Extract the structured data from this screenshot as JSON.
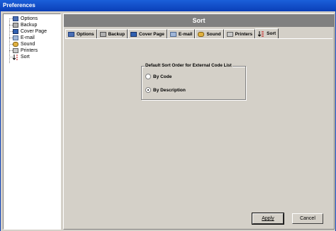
{
  "window": {
    "title": "Preferences"
  },
  "tree": {
    "items": [
      {
        "label": "Options",
        "icon": "options-icon",
        "color": "#4a6fb5"
      },
      {
        "label": "Backup",
        "icon": "backup-icon",
        "color": "#7f7f7f"
      },
      {
        "label": "Cover Page",
        "icon": "cover-page-icon",
        "color": "#3060b0"
      },
      {
        "label": "E-mail",
        "icon": "email-icon",
        "color": "#6f8fbf"
      },
      {
        "label": "Sound",
        "icon": "sound-icon",
        "color": "#c08a20"
      },
      {
        "label": "Printers",
        "icon": "printer-icon",
        "color": "#7f7f7f"
      },
      {
        "label": "Sort",
        "icon": "sort-icon",
        "color": "#000000"
      }
    ]
  },
  "main": {
    "header": "Sort",
    "tabs": [
      {
        "label": "Options"
      },
      {
        "label": "Backup"
      },
      {
        "label": "Cover Page"
      },
      {
        "label": "E-mail"
      },
      {
        "label": "Sound"
      },
      {
        "label": "Printers"
      },
      {
        "label": "Sort"
      }
    ],
    "active_tab": "Sort",
    "group": {
      "legend": "Default Sort Order for External Code List",
      "options": [
        {
          "label": "By Code",
          "selected": false
        },
        {
          "label": "By Description",
          "selected": true
        }
      ]
    }
  },
  "buttons": {
    "apply": "Apply",
    "cancel": "Cancel"
  },
  "colors": {
    "titlebar": "#0a3fb8",
    "header_band": "#808080",
    "face": "#d4d0c8"
  }
}
